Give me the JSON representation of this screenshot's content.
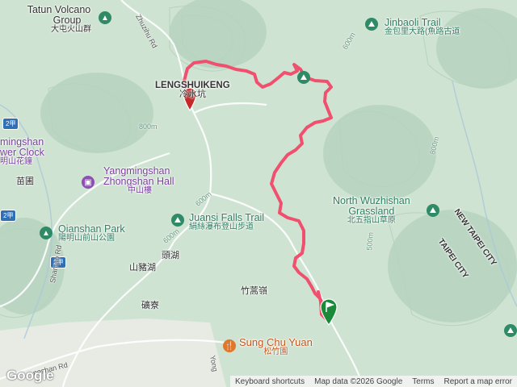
{
  "labels": {
    "tatun_en": "Tatun Volcano",
    "tatun_en2": "Group",
    "tatun_zh": "大屯火山群",
    "lengshuikeng_en": "LENGSHUIKENG",
    "lengshuikeng_zh": "冷水坑",
    "jinbaoli_en": "Jinbaoli Trail",
    "jinbaoli_zh": "金包里大路(魚路古道",
    "flower_clock_en1": "mingshan",
    "flower_clock_en2": "wer Clock",
    "flower_clock_zh": "明山花鐘",
    "zhongshan_en1": "Yangmingshan",
    "zhongshan_en2": "Zhongshan Hall",
    "zhongshan_zh": "中山樓",
    "juansi_en": "Juansi Falls Trail",
    "juansi_zh": "絹絲瀑布登山步道",
    "qianshan_en": "Qianshan Park",
    "qianshan_zh": "陽明山前山公園",
    "wuzhishan_en1": "North Wuzhishan",
    "wuzhishan_en2": "Grassland",
    "wuzhishan_zh": "北五指山草原",
    "new_taipei": "NEW TAIPEI CITY",
    "taipei": "TAIPEI CITY",
    "miaopu": "苗圃",
    "touhu": "頭湖",
    "shanzhuhu": "山豬湖",
    "zhuhaoling": "竹蒿嶺",
    "kuangliao": "礦寮",
    "sungchu_en": "Sung Chu Yuan",
    "sungchu_zh": "松竹園"
  },
  "roads": {
    "zhuzihu": "Zhuzihu Rd",
    "shamao": "Shamao Rd",
    "yangmingshan": "ngshan Rd",
    "yong": "Yong",
    "r2_1": "2甲",
    "r2_2": "2甲",
    "r2_3": "2甲",
    "elev_600_a": "600m",
    "elev_600_b": "600m",
    "elev_800_a": "800m",
    "elev_800_b": "800m",
    "elev_500": "500m",
    "elev_600_c": "600m"
  },
  "footer": {
    "keyboard": "Keyboard shortcuts",
    "mapdata": "Map data ©2026 Google",
    "terms": "Terms",
    "report": "Report a map error"
  },
  "logo": "Google",
  "colors": {
    "route": "#f0506e",
    "start_marker": "#1a8a3a",
    "end_marker": "#c62828"
  }
}
